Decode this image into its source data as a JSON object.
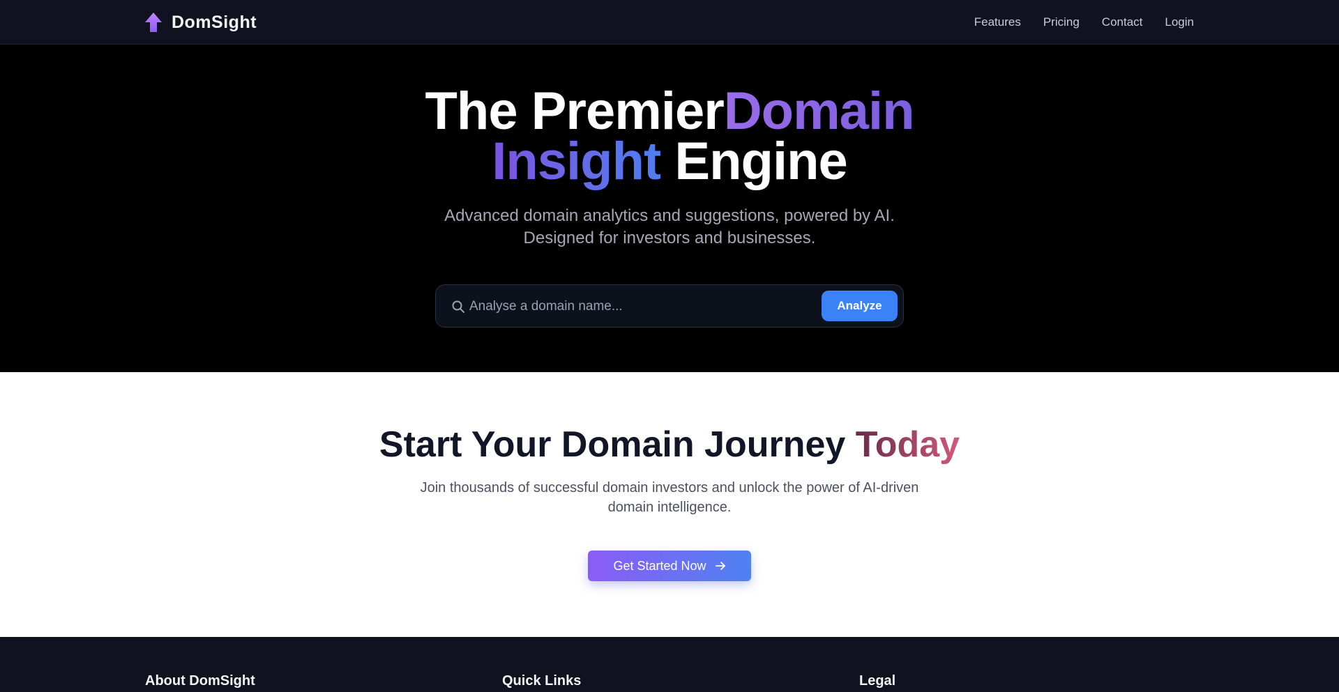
{
  "nav": {
    "brand": "DomSight",
    "links": [
      "Features",
      "Pricing",
      "Contact",
      "Login"
    ]
  },
  "hero": {
    "title_part1": "The Premier",
    "title_part2": "Domain",
    "title_part3": "Insight",
    "title_part4": "Engine",
    "subtitle_line1": "Advanced domain analytics and suggestions, powered by AI.",
    "subtitle_line2": "Designed for investors and businesses.",
    "search_placeholder": "Analyse a domain name...",
    "analyze_label": "Analyze"
  },
  "cta": {
    "title_main": "Start Your Domain Journey",
    "title_accent": "Today",
    "subtitle": "Join thousands of successful domain investors and unlock the power of AI-driven domain intelligence.",
    "button_label": "Get Started Now"
  },
  "footer": {
    "headings": [
      "About DomSight",
      "Quick Links",
      "Legal"
    ]
  },
  "colors": {
    "nav_bg": "#10131f",
    "accent_blue": "#3b82f6",
    "accent_purple": "#8b5cf6",
    "accent_rose": "#d05a7a"
  },
  "icons": {
    "brand": "arrow-up-icon",
    "search": "search-icon",
    "cta_arrow": "arrow-right-icon"
  }
}
